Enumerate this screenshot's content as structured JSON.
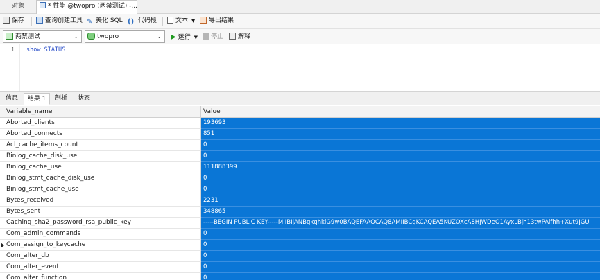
{
  "tabs": {
    "objects": "对象",
    "query": "* 性能 @twopro (两禁测试) -..."
  },
  "toolbar": {
    "save": "保存",
    "query_builder": "查询创建工具",
    "beautify": "美化 SQL",
    "snippet": "代码段",
    "text": "文本",
    "export": "导出结果"
  },
  "selectors": {
    "connection": "两禁测试",
    "database": "twopro"
  },
  "run": {
    "run": "运行",
    "stop": "停止",
    "explain": "解释"
  },
  "editor": {
    "line_number": "1",
    "code": "show STATUS"
  },
  "result_tabs": [
    "信息",
    "结果 1",
    "剖析",
    "状态"
  ],
  "grid": {
    "columns": [
      "Variable_name",
      "Value"
    ],
    "rows": [
      [
        "Aborted_clients",
        "193693"
      ],
      [
        "Aborted_connects",
        "851"
      ],
      [
        "Acl_cache_items_count",
        "0"
      ],
      [
        "Binlog_cache_disk_use",
        "0"
      ],
      [
        "Binlog_cache_use",
        "111888399"
      ],
      [
        "Binlog_stmt_cache_disk_use",
        "0"
      ],
      [
        "Binlog_stmt_cache_use",
        "0"
      ],
      [
        "Bytes_received",
        "2231"
      ],
      [
        "Bytes_sent",
        "348865"
      ],
      [
        "Caching_sha2_password_rsa_public_key",
        "-----BEGIN PUBLIC KEY-----MIIBIjANBgkqhkiG9w0BAQEFAAOCAQ8AMIIBCgKCAQEA5KUZOXcA8HJWDeO1AyxLBjh13twPAifhh+Xut9JGU"
      ],
      [
        "Com_admin_commands",
        "0"
      ],
      [
        "Com_assign_to_keycache",
        "0"
      ],
      [
        "Com_alter_db",
        "0"
      ],
      [
        "Com_alter_event",
        "0"
      ],
      [
        "Com_alter_function",
        "0"
      ]
    ]
  },
  "colors": {
    "selection": "#0a76d6",
    "keyword": "#2a4fc9"
  }
}
